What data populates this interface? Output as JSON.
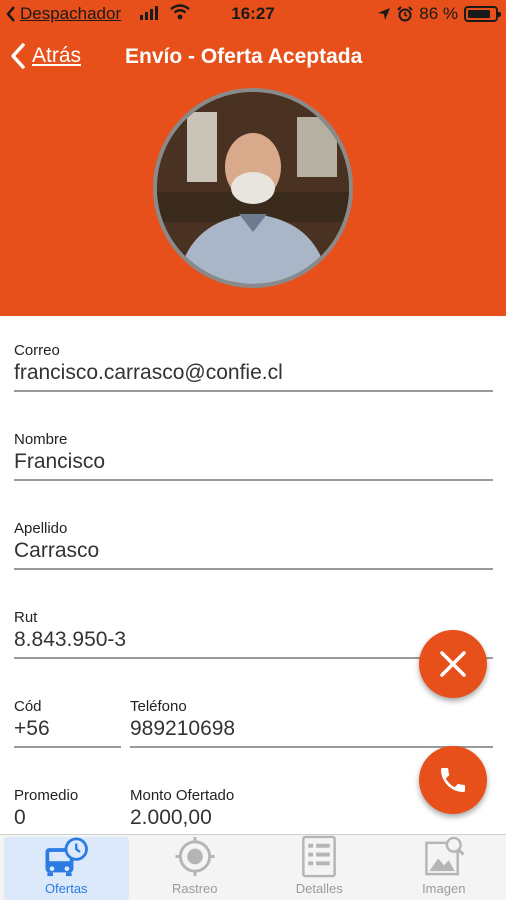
{
  "status_bar": {
    "back_app": "Despachador",
    "time": "16:27",
    "battery_percent_text": "86 %",
    "battery_level": 0.86
  },
  "nav": {
    "back_label": "Atrás",
    "title": "Envío - Oferta Aceptada"
  },
  "form": {
    "correo": {
      "label": "Correo",
      "value": "francisco.carrasco@confie.cl"
    },
    "nombre": {
      "label": "Nombre",
      "value": "Francisco"
    },
    "apellido": {
      "label": "Apellido",
      "value": "Carrasco"
    },
    "rut": {
      "label": "Rut",
      "value": "8.843.950-3"
    },
    "cod": {
      "label": "Cód",
      "value": "+56"
    },
    "telefono": {
      "label": "Teléfono",
      "value": "989210698"
    },
    "promedio": {
      "label": "Promedio",
      "value": "0"
    },
    "monto": {
      "label": "Monto Ofertado",
      "value": "2.000,00"
    }
  },
  "fabs": {
    "reject_icon": "close-icon",
    "call_icon": "phone-icon"
  },
  "tabs": [
    {
      "label": "Ofertas",
      "icon": "bus-clock-icon",
      "active": true
    },
    {
      "label": "Rastreo",
      "icon": "target-icon",
      "active": false
    },
    {
      "label": "Detalles",
      "icon": "list-icon",
      "active": false
    },
    {
      "label": "Imagen",
      "icon": "image-search-icon",
      "active": false
    }
  ],
  "colors": {
    "brand": "#e8501b",
    "tab_active": "#2a7be4"
  }
}
